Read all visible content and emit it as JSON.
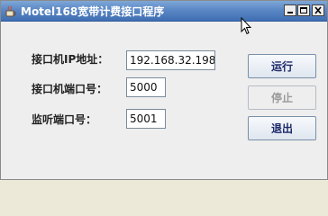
{
  "window": {
    "title": "Motel168宽带计费接口程序",
    "icon": "java-cup-icon",
    "controls": [
      "minimize",
      "maximize",
      "close"
    ]
  },
  "form": {
    "ip_label": "接口机IP地址：",
    "ip_value": "192.168.32.198",
    "port_label": "接口机端口号：",
    "port_value": "5000",
    "listen_label": "监听端口号：",
    "listen_value": "5001"
  },
  "buttons": {
    "run": "运行",
    "stop": "停止",
    "exit": "退出"
  },
  "colors": {
    "titlebar": "#4a7bbd",
    "button_text": "#1d2a6b",
    "disabled_text": "#9a9a9a"
  }
}
